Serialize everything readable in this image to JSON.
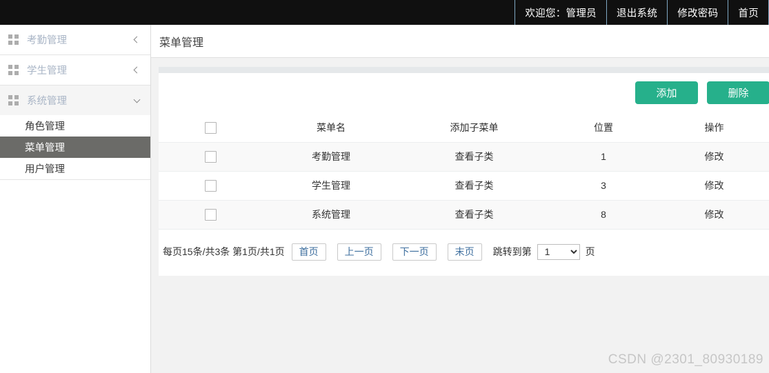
{
  "topbar": {
    "items": [
      {
        "label": "欢迎您：管理员",
        "name": "welcome-admin"
      },
      {
        "label": "退出系统",
        "name": "logout"
      },
      {
        "label": "修改密码",
        "name": "change-password"
      },
      {
        "label": "首页",
        "name": "home"
      }
    ]
  },
  "sidebar": {
    "groups": [
      {
        "label": "考勤管理",
        "icon": "grid-icon",
        "expanded": false,
        "chevron": "chevron-left-icon",
        "children": []
      },
      {
        "label": "学生管理",
        "icon": "grid-icon",
        "expanded": false,
        "chevron": "chevron-left-icon",
        "children": []
      },
      {
        "label": "系统管理",
        "icon": "grid-icon",
        "expanded": true,
        "chevron": "chevron-down-icon",
        "children": [
          {
            "label": "角色管理",
            "active": false
          },
          {
            "label": "菜单管理",
            "active": true
          },
          {
            "label": "用户管理",
            "active": false
          }
        ]
      }
    ]
  },
  "page": {
    "title": "菜单管理"
  },
  "toolbar": {
    "add_label": "添加",
    "delete_label": "删除",
    "accent_color": "#26b08b"
  },
  "table": {
    "headers": [
      "",
      "菜单名",
      "添加子菜单",
      "位置",
      "操作"
    ],
    "rows": [
      {
        "name": "考勤管理",
        "sub": "查看子类",
        "pos": "1",
        "op": "修改"
      },
      {
        "name": "学生管理",
        "sub": "查看子类",
        "pos": "3",
        "op": "修改"
      },
      {
        "name": "系统管理",
        "sub": "查看子类",
        "pos": "8",
        "op": "修改"
      }
    ]
  },
  "pager": {
    "info": "每页15条/共3条 第1页/共1页",
    "first": "首页",
    "prev": "上一页",
    "next": "下一页",
    "last": "末页",
    "jump_label": "跳转到第",
    "selected_page": "1",
    "page_options": [
      "1"
    ],
    "page_suffix": "页"
  },
  "watermark": {
    "text": "CSDN @2301_80930189"
  }
}
